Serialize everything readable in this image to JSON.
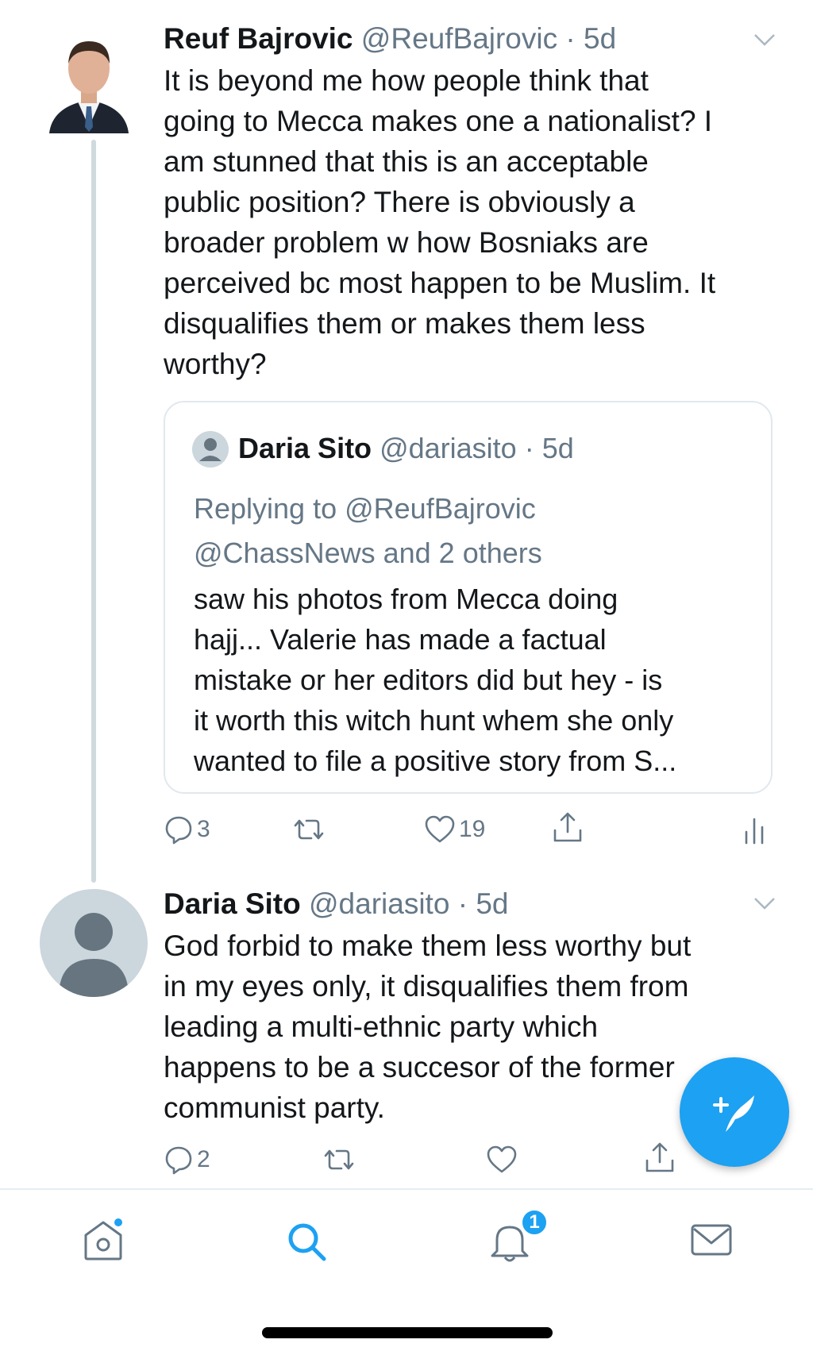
{
  "tweet1": {
    "name": "Reuf Bajrovic",
    "handle": "@ReufBajrovic",
    "time": "5d",
    "body_lines": [
      "It is beyond me how people think that",
      "going to Mecca makes one a nationalist? I",
      "am stunned that this is an acceptable",
      "public position? There is obviously a",
      "broader problem w how Bosniaks are",
      "perceived bc most happen to be Muslim. It",
      "disqualifies them or makes them less",
      "worthy?"
    ],
    "quote": {
      "name": "Daria Sito",
      "handle": "@dariasito",
      "time": "5d",
      "reply_lines": [
        "Replying to @ReufBajrovic",
        "@ChassNews and 2 others"
      ],
      "body_lines": [
        "saw his photos from Mecca doing",
        "hajj... Valerie has made a factual",
        "mistake or her editors did but hey - is",
        "it worth this witch hunt whem she only",
        "wanted to file a positive story from S..."
      ]
    },
    "replies": "3",
    "likes": "19"
  },
  "tweet2": {
    "name": "Daria Sito",
    "handle": "@dariasito",
    "time": "5d",
    "body_lines": [
      "God forbid to make them less worthy but",
      "in my eyes only, it disqualifies them from",
      "leading a multi-ethnic party which",
      "happens to be a succesor of the former",
      "communist party."
    ],
    "replies": "2"
  },
  "nav": {
    "notifications_badge": "1",
    "icons": [
      "home-icon",
      "search-icon",
      "notifications-icon",
      "messages-icon"
    ]
  },
  "colors": {
    "accent": "#1da1f2",
    "secondary_text": "#657786",
    "divider": "#e1e8ed"
  }
}
